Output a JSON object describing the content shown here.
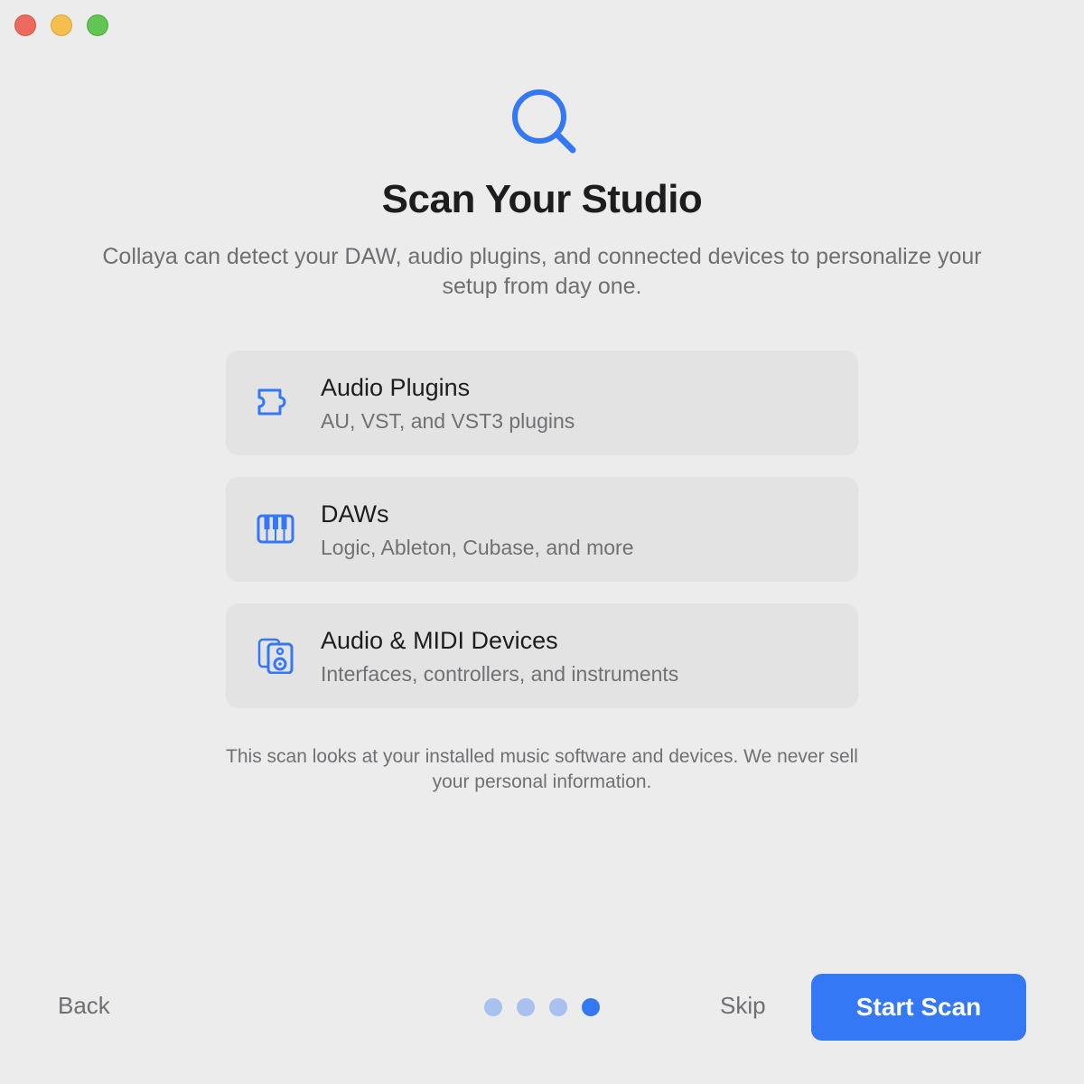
{
  "window": {
    "controls": [
      "close",
      "minimize",
      "zoom"
    ]
  },
  "hero": {
    "icon": "search-icon",
    "title": "Scan Your Studio",
    "subtitle": "Collaya can detect your DAW, audio plugins, and connected devices to personalize your setup from day one."
  },
  "cards": [
    {
      "icon": "puzzle-icon",
      "title": "Audio Plugins",
      "description": "AU, VST, and VST3 plugins"
    },
    {
      "icon": "piano-keys-icon",
      "title": "DAWs",
      "description": "Logic, Ableton, Cubase, and more"
    },
    {
      "icon": "speaker-icon",
      "title": "Audio & MIDI Devices",
      "description": "Interfaces, controllers, and instruments"
    }
  ],
  "privacy_note": "This scan looks at your installed music software and devices. We never sell your personal information.",
  "footer": {
    "back_label": "Back",
    "skip_label": "Skip",
    "primary_label": "Start Scan",
    "steps_total": 4,
    "current_step": 4
  },
  "colors": {
    "accent": "#3478f6",
    "inactive_dot": "#a9c1ee",
    "background": "#ececec",
    "card_background": "#e3e3e3"
  }
}
